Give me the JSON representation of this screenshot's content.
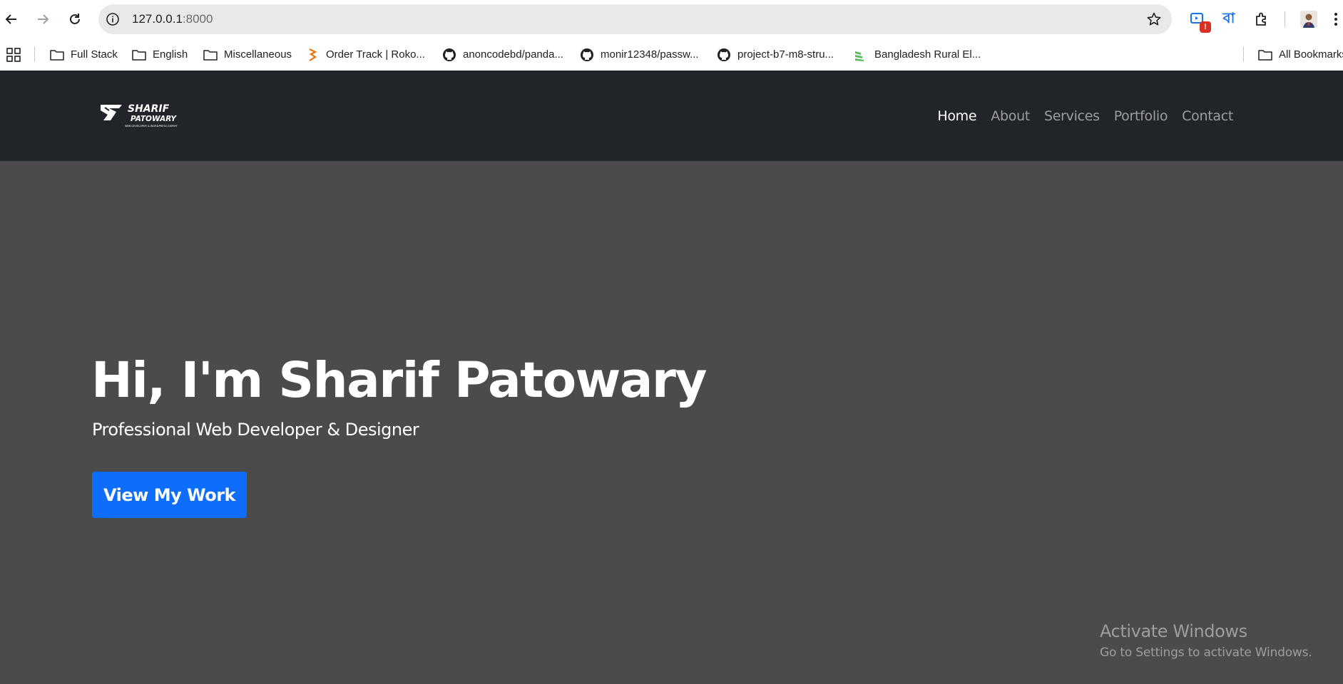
{
  "browser": {
    "url_host": "127.0.0.1",
    "url_port": ":8000",
    "extension_badge": "!",
    "bangla_extension": "বা"
  },
  "bookmarks": {
    "items": [
      {
        "label": "Full Stack",
        "icon": "folder-icon"
      },
      {
        "label": "English",
        "icon": "folder-icon"
      },
      {
        "label": "Miscellaneous",
        "icon": "folder-icon"
      },
      {
        "label": "Order Track | Roko...",
        "icon": "site-favicon"
      },
      {
        "label": "anoncodebd/panda...",
        "icon": "github-icon"
      },
      {
        "label": "monir12348/passw...",
        "icon": "github-icon"
      },
      {
        "label": "project-b7-m8-stru...",
        "icon": "github-icon"
      },
      {
        "label": "Bangladesh Rural El...",
        "icon": "site-favicon"
      }
    ],
    "all_bookmarks": "All Bookmarks"
  },
  "site": {
    "logo_name": "SHARIF",
    "logo_surname": "PATOWARY",
    "logo_tagline": "WEB DEVELOPER & WORDPRESS EXPERT",
    "nav": [
      {
        "label": "Home",
        "active": true
      },
      {
        "label": "About",
        "active": false
      },
      {
        "label": "Services",
        "active": false
      },
      {
        "label": "Portfolio",
        "active": false
      },
      {
        "label": "Contact",
        "active": false
      }
    ]
  },
  "hero": {
    "title": "Hi, I'm Sharif Patowary",
    "subtitle": "Professional Web Developer & Designer",
    "cta_label": "View My Work"
  },
  "watermark": {
    "line1": "Activate Windows",
    "line2": "Go to Settings to activate Windows."
  },
  "colors": {
    "navbar_bg": "#212529",
    "hero_bg": "#4b4b4b",
    "cta_bg": "#0d6efd"
  }
}
